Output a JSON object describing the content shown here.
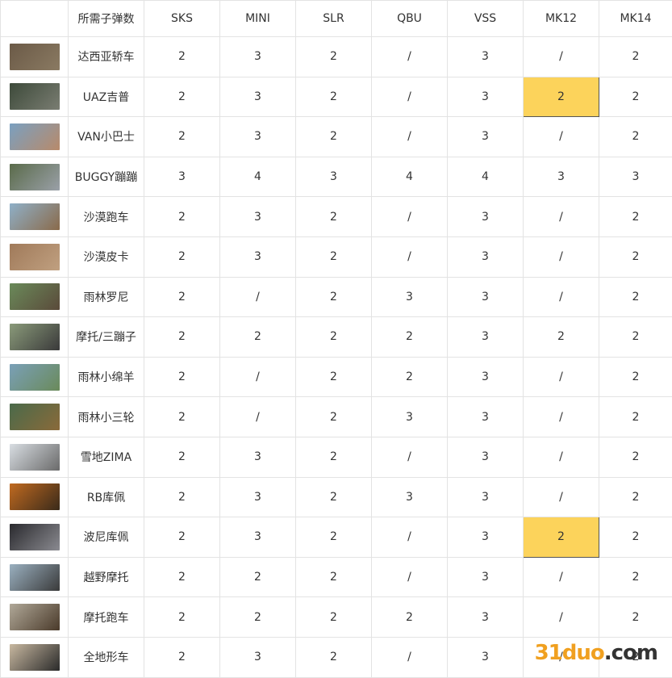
{
  "header": [
    "所需子弹数",
    "SKS",
    "MINI",
    "SLR",
    "QBU",
    "VSS",
    "MK12",
    "MK14"
  ],
  "rows": [
    {
      "name": "达西亚轿车",
      "values": [
        "2",
        "3",
        "2",
        "/",
        "3",
        "/",
        "2"
      ],
      "thumb": [
        "#6b5a47",
        "#8a7a62"
      ],
      "highlight": -1
    },
    {
      "name": "UAZ吉普",
      "values": [
        "2",
        "3",
        "2",
        "/",
        "3",
        "2",
        "2"
      ],
      "thumb": [
        "#3d4a3a",
        "#7a7d72"
      ],
      "highlight": 5
    },
    {
      "name": "VAN小巴士",
      "values": [
        "2",
        "3",
        "2",
        "/",
        "3",
        "/",
        "2"
      ],
      "thumb": [
        "#7aa0c0",
        "#b88a6a"
      ],
      "highlight": -1
    },
    {
      "name": "BUGGY蹦蹦",
      "values": [
        "3",
        "4",
        "3",
        "4",
        "4",
        "3",
        "3"
      ],
      "thumb": [
        "#5a6b4a",
        "#9aa0a8"
      ],
      "highlight": -1
    },
    {
      "name": "沙漠跑车",
      "values": [
        "2",
        "3",
        "2",
        "/",
        "3",
        "/",
        "2"
      ],
      "thumb": [
        "#8fb0c8",
        "#8a6a4a"
      ],
      "highlight": -1
    },
    {
      "name": "沙漠皮卡",
      "values": [
        "2",
        "3",
        "2",
        "/",
        "3",
        "/",
        "2"
      ],
      "thumb": [
        "#a07a5a",
        "#c0a080"
      ],
      "highlight": -1
    },
    {
      "name": "雨林罗尼",
      "values": [
        "2",
        "/",
        "2",
        "3",
        "3",
        "/",
        "2"
      ],
      "thumb": [
        "#6a8a5a",
        "#5a4a3a"
      ],
      "highlight": -1
    },
    {
      "name": "摩托/三蹦子",
      "values": [
        "2",
        "2",
        "2",
        "2",
        "3",
        "2",
        "2"
      ],
      "thumb": [
        "#8a9a7a",
        "#3a3a3a"
      ],
      "highlight": -1
    },
    {
      "name": "雨林小绵羊",
      "values": [
        "2",
        "/",
        "2",
        "2",
        "3",
        "/",
        "2"
      ],
      "thumb": [
        "#7aa0b8",
        "#6a8a5a"
      ],
      "highlight": -1
    },
    {
      "name": "雨林小三轮",
      "values": [
        "2",
        "/",
        "2",
        "3",
        "3",
        "/",
        "2"
      ],
      "thumb": [
        "#4a6a4a",
        "#8a6a3a"
      ],
      "highlight": -1
    },
    {
      "name": "雪地ZIMA",
      "values": [
        "2",
        "3",
        "2",
        "/",
        "3",
        "/",
        "2"
      ],
      "thumb": [
        "#d8dde2",
        "#6a6a6a"
      ],
      "highlight": -1
    },
    {
      "name": "RB库佩",
      "values": [
        "2",
        "3",
        "2",
        "3",
        "3",
        "/",
        "2"
      ],
      "thumb": [
        "#c06a20",
        "#3a2a1a"
      ],
      "highlight": -1
    },
    {
      "name": "波尼库佩",
      "values": [
        "2",
        "3",
        "2",
        "/",
        "3",
        "2",
        "2"
      ],
      "thumb": [
        "#2a2a2e",
        "#8a8a90"
      ],
      "highlight": 5
    },
    {
      "name": "越野摩托",
      "values": [
        "2",
        "2",
        "2",
        "/",
        "3",
        "/",
        "2"
      ],
      "thumb": [
        "#9ab0c0",
        "#3a3a3a"
      ],
      "highlight": -1
    },
    {
      "name": "摩托跑车",
      "values": [
        "2",
        "2",
        "2",
        "2",
        "3",
        "/",
        "2"
      ],
      "thumb": [
        "#b0a898",
        "#4a3a2a"
      ],
      "highlight": -1
    },
    {
      "name": "全地形车",
      "values": [
        "2",
        "3",
        "2",
        "/",
        "3",
        "/",
        "2"
      ],
      "thumb": [
        "#c8b8a0",
        "#2a2a2a"
      ],
      "highlight": -1
    }
  ],
  "watermark": {
    "brand": "31duo",
    "suffix": ".com"
  }
}
